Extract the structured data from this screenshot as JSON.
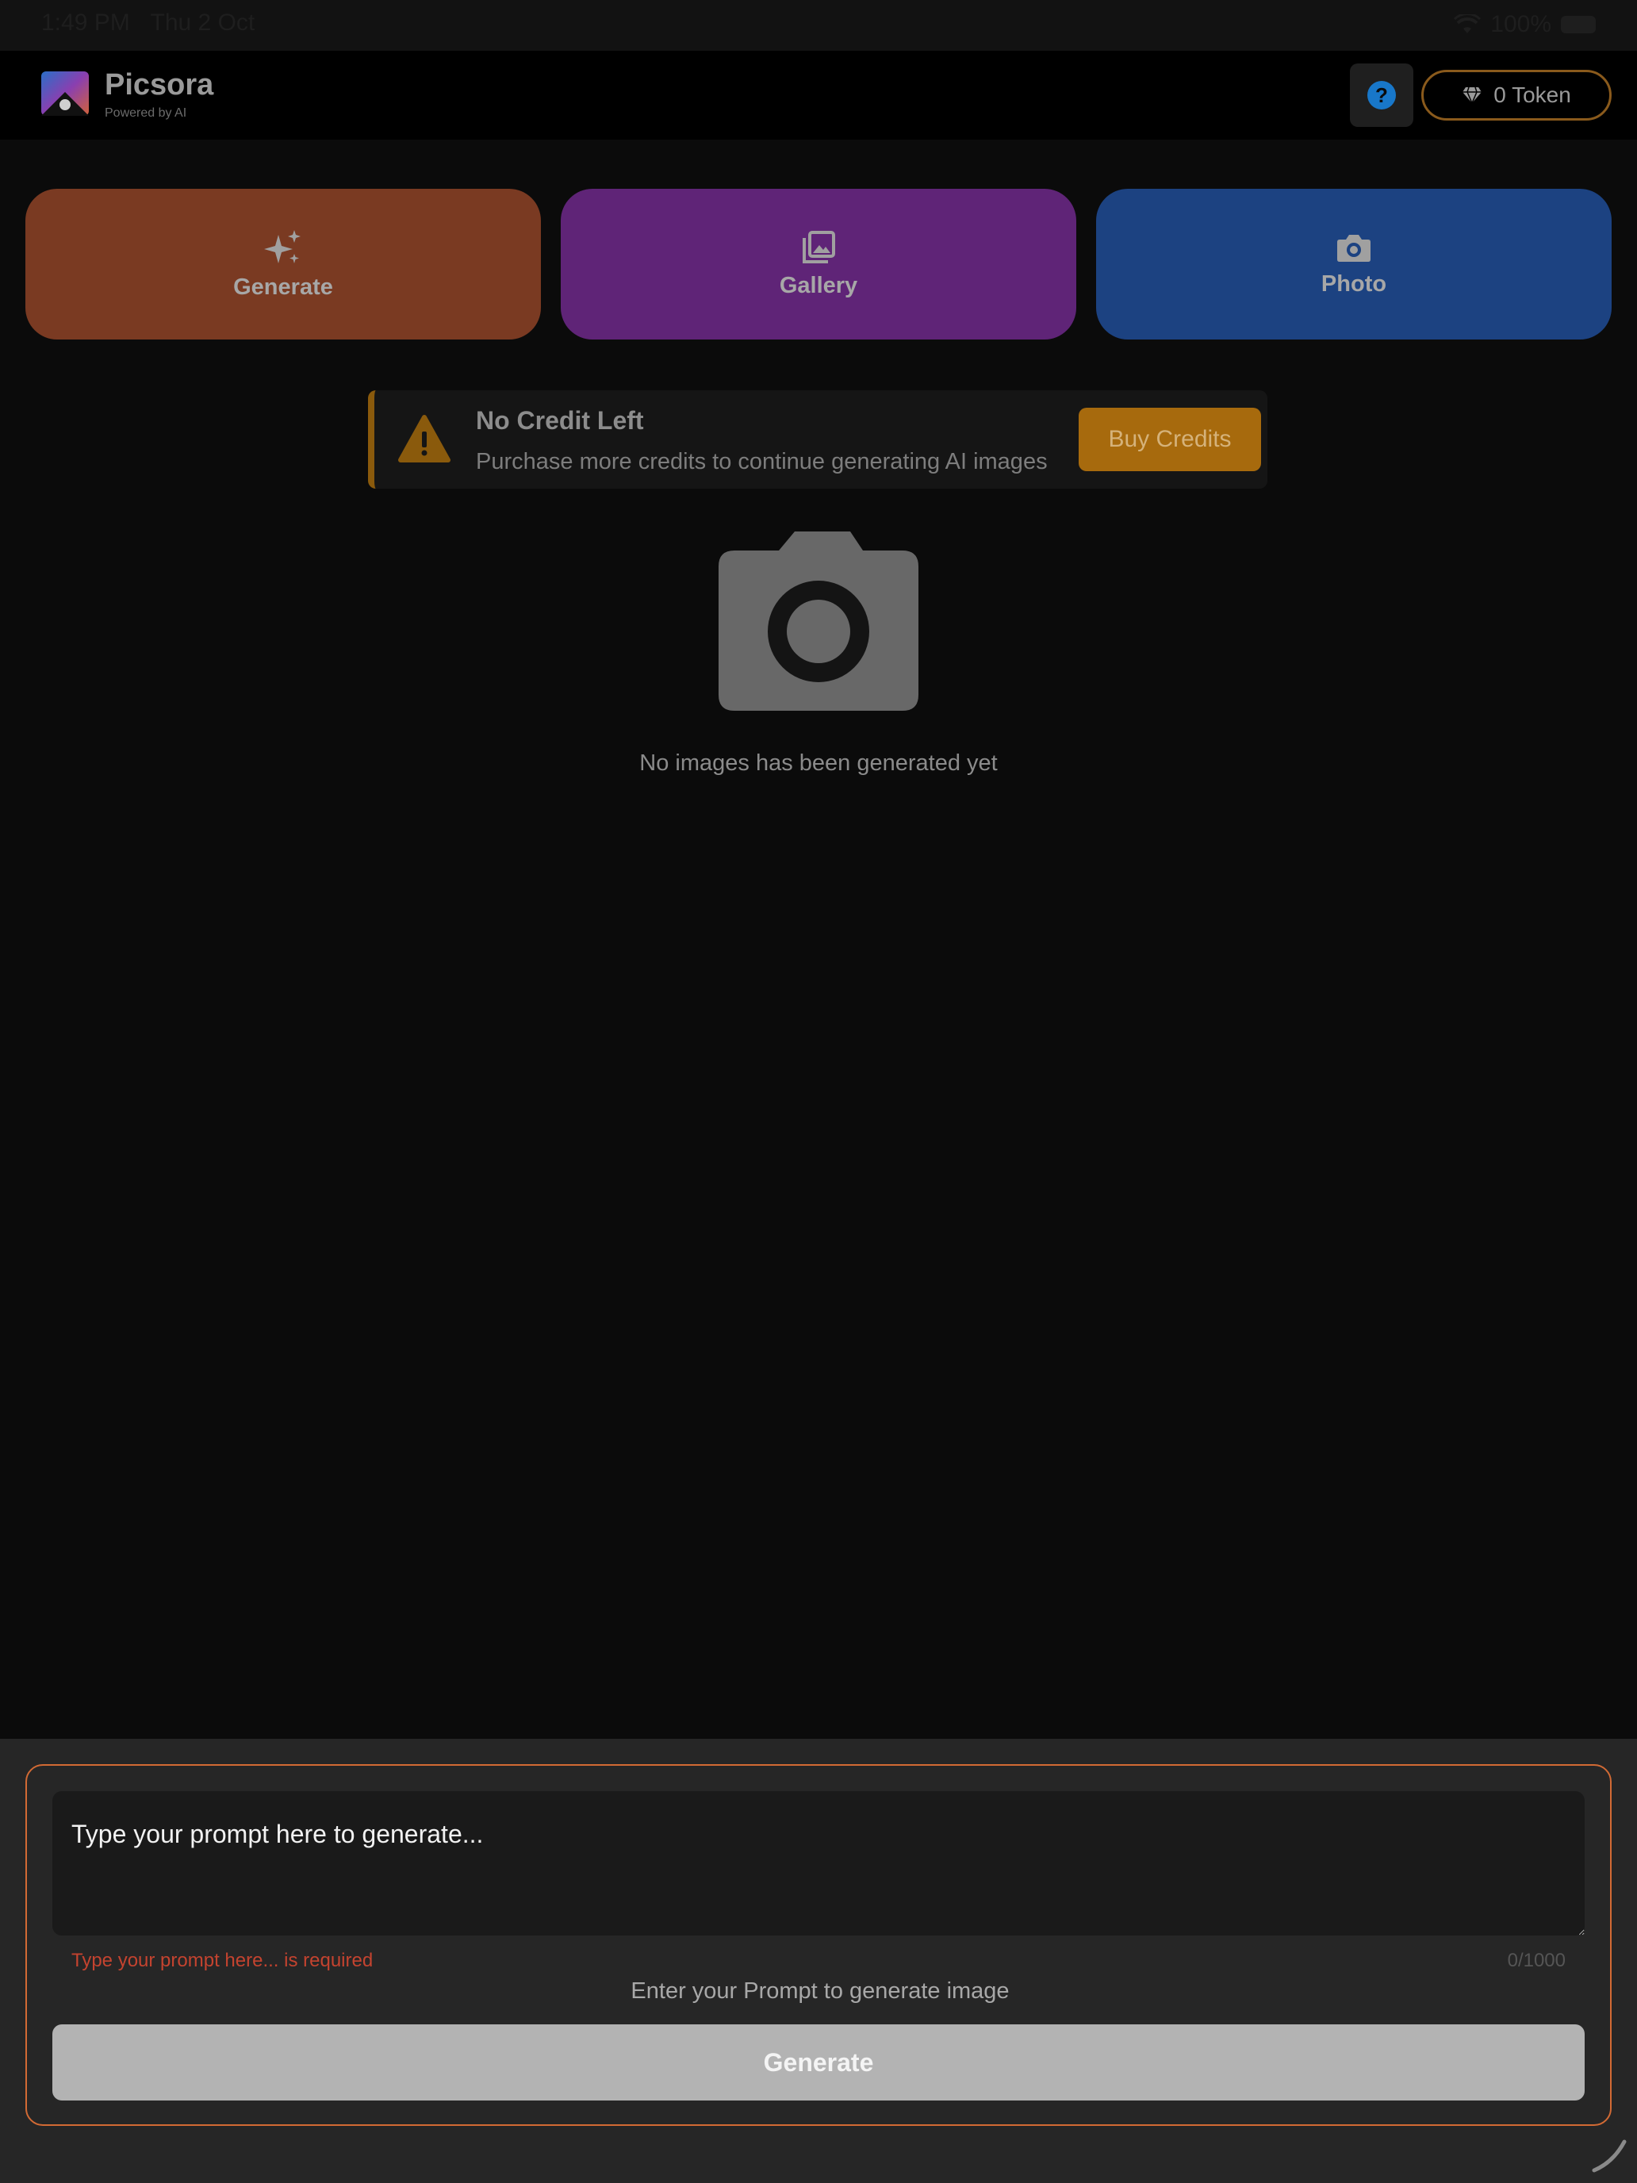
{
  "status_bar": {
    "time": "1:49 PM",
    "date": "Thu 2 Oct",
    "battery": "100%"
  },
  "header": {
    "app_name": "Picsora",
    "tagline": "Powered by AI",
    "help_label": "?",
    "token_label": "0 Token"
  },
  "actions": [
    {
      "label": "Generate",
      "icon": "sparkles-icon",
      "color": "#7a3a22"
    },
    {
      "label": "Gallery",
      "icon": "image-stack-icon",
      "color": "#5f2477"
    },
    {
      "label": "Photo",
      "icon": "camera-icon",
      "color": "#1c4281"
    }
  ],
  "alert": {
    "title": "No Credit Left",
    "message": "Purchase more credits to continue generating AI images",
    "button_label": "Buy Credits",
    "accent_color": "#a76a0d"
  },
  "empty_state": {
    "text": "No images has been generated yet"
  },
  "prompt": {
    "placeholder": "Type your prompt here to generate...",
    "value": "",
    "error": "Type your prompt here... is required",
    "counter": "0/1000",
    "hint": "Enter your Prompt to generate image",
    "button_label": "Generate",
    "border_color": "#d26a34"
  }
}
